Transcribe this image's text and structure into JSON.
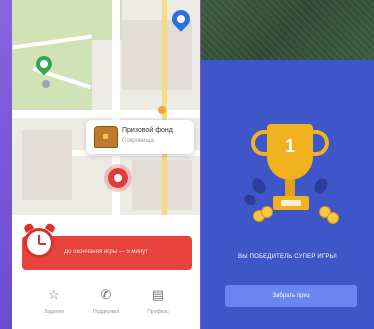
{
  "left_screen": {
    "map": {
      "callout": {
        "title": "Призовой фонд",
        "subtitle": "Сокровища"
      }
    },
    "banner": {
      "text": "До окончания игры — 5 минут",
      "accent": "#e8423f"
    },
    "bottom_nav": [
      {
        "name": "star-icon",
        "icon": "☆",
        "label": "Задания"
      },
      {
        "name": "phone-icon",
        "icon": "✆",
        "label": "Поддержка"
      },
      {
        "name": "map-icon",
        "icon": "▤",
        "label": "Профиль"
      }
    ]
  },
  "right_screen": {
    "trophy_number": "1",
    "winner_text": "ВЫ ПОБЕДИТЕЛЬ СУПЕР ИГРЫ!",
    "claim_button": "Забрать приз",
    "accent": "#6b86f2",
    "background": "#3f56c9"
  }
}
